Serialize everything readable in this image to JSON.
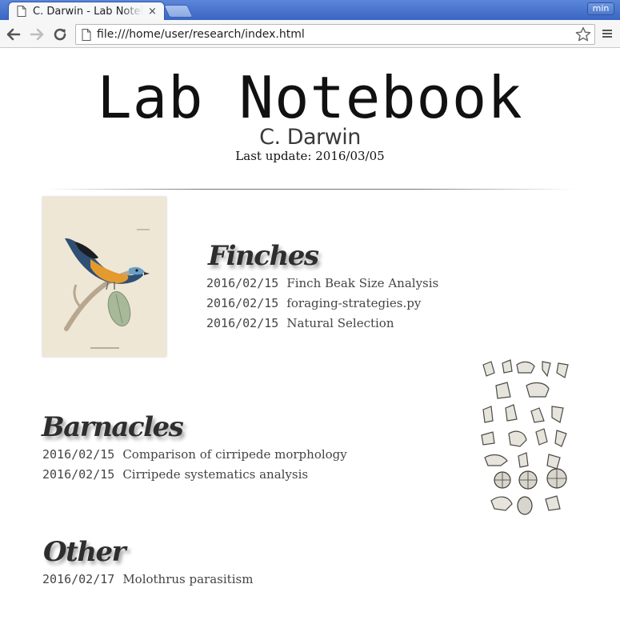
{
  "browser": {
    "tab_title": "C. Darwin - Lab Notebook",
    "tab_close": "×",
    "min_label": "min",
    "url": "file:///home/user/research/index.html"
  },
  "page": {
    "title": "Lab Notebook",
    "author": "C. Darwin",
    "last_update": "Last update: 2016/03/05"
  },
  "sections": [
    {
      "heading": "Finches",
      "entries": [
        {
          "date": "2016/02/15",
          "title": "Finch Beak Size Analysis"
        },
        {
          "date": "2016/02/15",
          "title": "foraging-strategies.py"
        },
        {
          "date": "2016/02/15",
          "title": "Natural Selection"
        }
      ]
    },
    {
      "heading": "Barnacles",
      "entries": [
        {
          "date": "2016/02/15",
          "title": "Comparison of cirripede morphology"
        },
        {
          "date": "2016/02/15",
          "title": "Cirripede systematics analysis"
        }
      ]
    },
    {
      "heading": "Other",
      "entries": [
        {
          "date": "2016/02/17",
          "title": "Molothrus parasitism"
        }
      ]
    }
  ],
  "icons": {
    "back": "arrow-left-icon",
    "forward": "arrow-right-icon",
    "reload": "reload-icon",
    "page": "page-icon",
    "bookmark": "star-icon",
    "menu": "hamburger-menu-icon"
  }
}
